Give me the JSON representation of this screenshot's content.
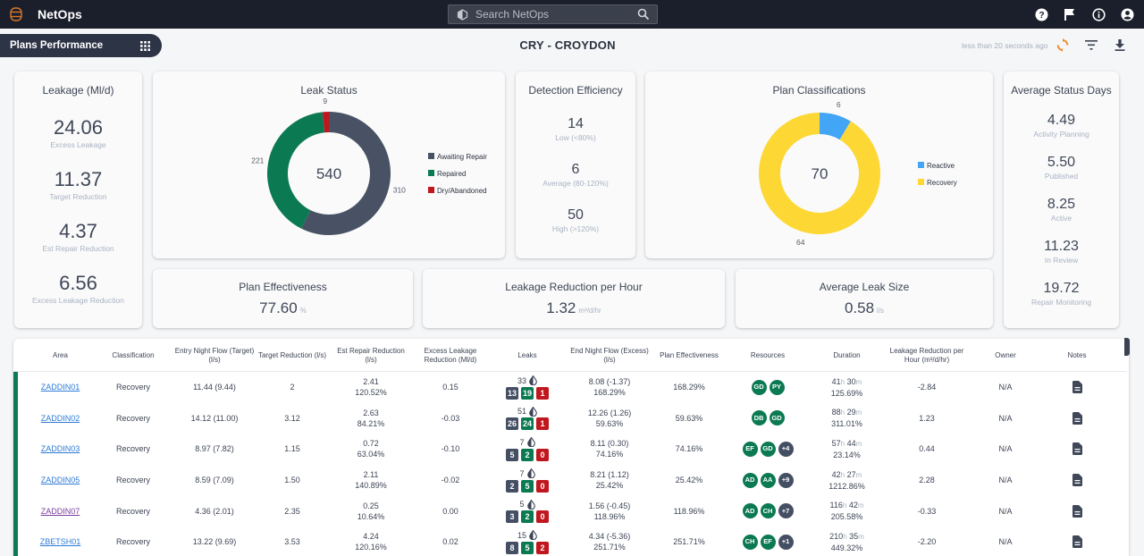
{
  "app": {
    "brand": "NetOps",
    "search_placeholder": "Search NetOps",
    "top_icons": [
      "help-icon",
      "flag-icon",
      "info-icon",
      "account-icon"
    ]
  },
  "page": {
    "section_label": "Plans Performance",
    "title": "CRY - CROYDON",
    "last_updated": "less than 20 seconds ago",
    "tools": [
      "refresh-icon",
      "filter-icon",
      "download-icon"
    ]
  },
  "colors": {
    "awaiting": "#485264",
    "repaired": "#0b7a52",
    "dry": "#c0171f",
    "reactive": "#42a5f5",
    "recovery": "#fdd835"
  },
  "leakage": {
    "title": "Leakage (Ml/d)",
    "stats": [
      {
        "value": "24.06",
        "label": "Excess Leakage"
      },
      {
        "value": "11.37",
        "label": "Target Reduction"
      },
      {
        "value": "4.37",
        "label": "Est Repair Reduction"
      },
      {
        "value": "6.56",
        "label": "Excess Leakage Reduction"
      }
    ]
  },
  "detection": {
    "title": "Detection Efficiency",
    "stats": [
      {
        "value": "14",
        "label": "Low (<80%)"
      },
      {
        "value": "6",
        "label": "Average (80-120%)"
      },
      {
        "value": "50",
        "label": "High (>120%)"
      }
    ]
  },
  "status_days": {
    "title": "Average Status Days",
    "stats": [
      {
        "value": "4.49",
        "label": "Activity Planning"
      },
      {
        "value": "5.50",
        "label": "Published"
      },
      {
        "value": "8.25",
        "label": "Active"
      },
      {
        "value": "11.23",
        "label": "In Review"
      },
      {
        "value": "19.72",
        "label": "Repair Monitoring"
      }
    ]
  },
  "kpis": [
    {
      "title": "Plan Effectiveness",
      "value": "77.60",
      "unit": "%"
    },
    {
      "title": "Leakage Reduction per Hour",
      "value": "1.32",
      "unit": "m³/d/hr"
    },
    {
      "title": "Average Leak Size",
      "value": "0.58",
      "unit": "l/s"
    }
  ],
  "chart_data": [
    {
      "type": "pie",
      "title": "Leak Status",
      "total": 540,
      "categories": [
        "Awaiting Repair",
        "Repaired",
        "Dry/Abandoned"
      ],
      "values": [
        310,
        221,
        9
      ],
      "legend": "right"
    },
    {
      "type": "pie",
      "title": "Plan Classifications",
      "total": 70,
      "categories": [
        "Reactive",
        "Recovery"
      ],
      "values": [
        6,
        64
      ],
      "legend": "right"
    }
  ],
  "table": {
    "columns": [
      "Area",
      "Classification",
      "Entry Night Flow (Target) (l/s)",
      "Target Reduction (l/s)",
      "Est Repair Reduction (l/s)",
      "Excess Leakage Reduction (Ml/d)",
      "Leaks",
      "End Night Flow (Excess) (l/s)",
      "Plan Effectiveness",
      "Resources",
      "Duration",
      "Leakage Reduction per Hour (m³/d/hr)",
      "Owner",
      "Notes"
    ],
    "rows": [
      {
        "area": "ZADDIN01",
        "visited": false,
        "classification": "Recovery",
        "entry": "11.44 (9.44)",
        "target": "2",
        "est1": "2.41",
        "est2": "120.52%",
        "excess": "0.15",
        "leaks": "33",
        "awaiting": "13",
        "repaired": "19",
        "dry": "1",
        "end1": "8.08 (-1.37)",
        "end2": "168.29%",
        "effect": "168.29%",
        "resources": [
          "GD",
          "PY"
        ],
        "more": "",
        "h": "41",
        "m": "30",
        "dur_pct": "125.69%",
        "lrph": "-2.84",
        "owner": "N/A"
      },
      {
        "area": "ZADDIN02",
        "visited": false,
        "classification": "Recovery",
        "entry": "14.12 (11.00)",
        "target": "3.12",
        "est1": "2.63",
        "est2": "84.21%",
        "excess": "-0.03",
        "leaks": "51",
        "awaiting": "26",
        "repaired": "24",
        "dry": "1",
        "end1": "12.26 (1.26)",
        "end2": "59.63%",
        "effect": "59.63%",
        "resources": [
          "DB",
          "GD"
        ],
        "more": "",
        "h": "88",
        "m": "29",
        "dur_pct": "311.01%",
        "lrph": "1.23",
        "owner": "N/A"
      },
      {
        "area": "ZADDIN03",
        "visited": false,
        "classification": "Recovery",
        "entry": "8.97 (7.82)",
        "target": "1.15",
        "est1": "0.72",
        "est2": "63.04%",
        "excess": "-0.10",
        "leaks": "7",
        "awaiting": "5",
        "repaired": "2",
        "dry": "0",
        "end1": "8.11 (0.30)",
        "end2": "74.16%",
        "effect": "74.16%",
        "resources": [
          "EF",
          "GD"
        ],
        "more": "+4",
        "h": "57",
        "m": "44",
        "dur_pct": "23.14%",
        "lrph": "0.44",
        "owner": "N/A"
      },
      {
        "area": "ZADDIN05",
        "visited": false,
        "classification": "Recovery",
        "entry": "8.59 (7.09)",
        "target": "1.50",
        "est1": "2.11",
        "est2": "140.89%",
        "excess": "-0.02",
        "leaks": "7",
        "awaiting": "2",
        "repaired": "5",
        "dry": "0",
        "end1": "8.21 (1.12)",
        "end2": "25.42%",
        "effect": "25.42%",
        "resources": [
          "AD",
          "AA"
        ],
        "more": "+9",
        "h": "42",
        "m": "27",
        "dur_pct": "1212.86%",
        "lrph": "2.28",
        "owner": "N/A"
      },
      {
        "area": "ZADDIN07",
        "visited": true,
        "classification": "Recovery",
        "entry": "4.36 (2.01)",
        "target": "2.35",
        "est1": "0.25",
        "est2": "10.64%",
        "excess": "0.00",
        "leaks": "5",
        "awaiting": "3",
        "repaired": "2",
        "dry": "0",
        "end1": "1.56 (-0.45)",
        "end2": "118.96%",
        "effect": "118.96%",
        "resources": [
          "AD",
          "CH"
        ],
        "more": "+7",
        "h": "116",
        "m": "42",
        "dur_pct": "205.58%",
        "lrph": "-0.33",
        "owner": "N/A"
      },
      {
        "area": "ZBETSH01",
        "visited": false,
        "classification": "Recovery",
        "entry": "13.22 (9.69)",
        "target": "3.53",
        "est1": "4.24",
        "est2": "120.16%",
        "excess": "0.02",
        "leaks": "15",
        "awaiting": "8",
        "repaired": "5",
        "dry": "2",
        "end1": "4.34 (-5.36)",
        "end2": "251.71%",
        "effect": "251.71%",
        "resources": [
          "CH",
          "EF"
        ],
        "more": "+1",
        "h": "210",
        "m": "35",
        "dur_pct": "449.32%",
        "lrph": "-2.20",
        "owner": "N/A"
      }
    ],
    "duration_units": {
      "h": "h",
      "m": "m"
    }
  }
}
